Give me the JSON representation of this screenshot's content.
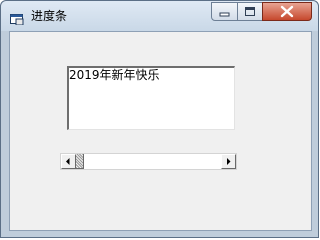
{
  "window": {
    "title": "进度条",
    "buttons": {
      "minimize_icon": "minimize-icon",
      "maximize_icon": "maximize-icon",
      "close_icon": "close-icon"
    }
  },
  "textbox": {
    "value": "2019年新年快乐"
  },
  "scrollbar": {
    "orientation": "horizontal",
    "position": 0.0
  },
  "colors": {
    "client_bg": "#f0f0f0",
    "close_button": "#c6482d",
    "titlebar": "#c9d8e7"
  }
}
